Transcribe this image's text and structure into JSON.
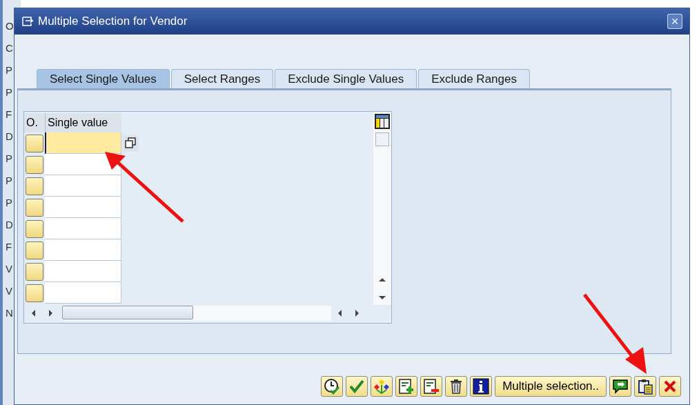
{
  "background_fragments": [
    "O",
    "C",
    "P",
    "P",
    "F",
    "D",
    "P",
    "P",
    "P",
    "D",
    "F",
    "V",
    "V",
    "N"
  ],
  "window": {
    "title": "Multiple Selection for Vendor",
    "close": "×"
  },
  "tabs": [
    {
      "label": "Select Single Values",
      "selected": true
    },
    {
      "label": "Select Ranges",
      "selected": false
    },
    {
      "label": "Exclude Single Values",
      "selected": false
    },
    {
      "label": "Exclude Ranges",
      "selected": false
    }
  ],
  "table": {
    "columns": [
      "O.",
      "Single value"
    ],
    "rows": [
      {
        "selected": true
      },
      {
        "selected": false
      },
      {
        "selected": false
      },
      {
        "selected": false
      },
      {
        "selected": false
      },
      {
        "selected": false
      },
      {
        "selected": false
      },
      {
        "selected": false
      }
    ]
  },
  "toolbar": {
    "multiple_selection": "Multiple selection.."
  }
}
